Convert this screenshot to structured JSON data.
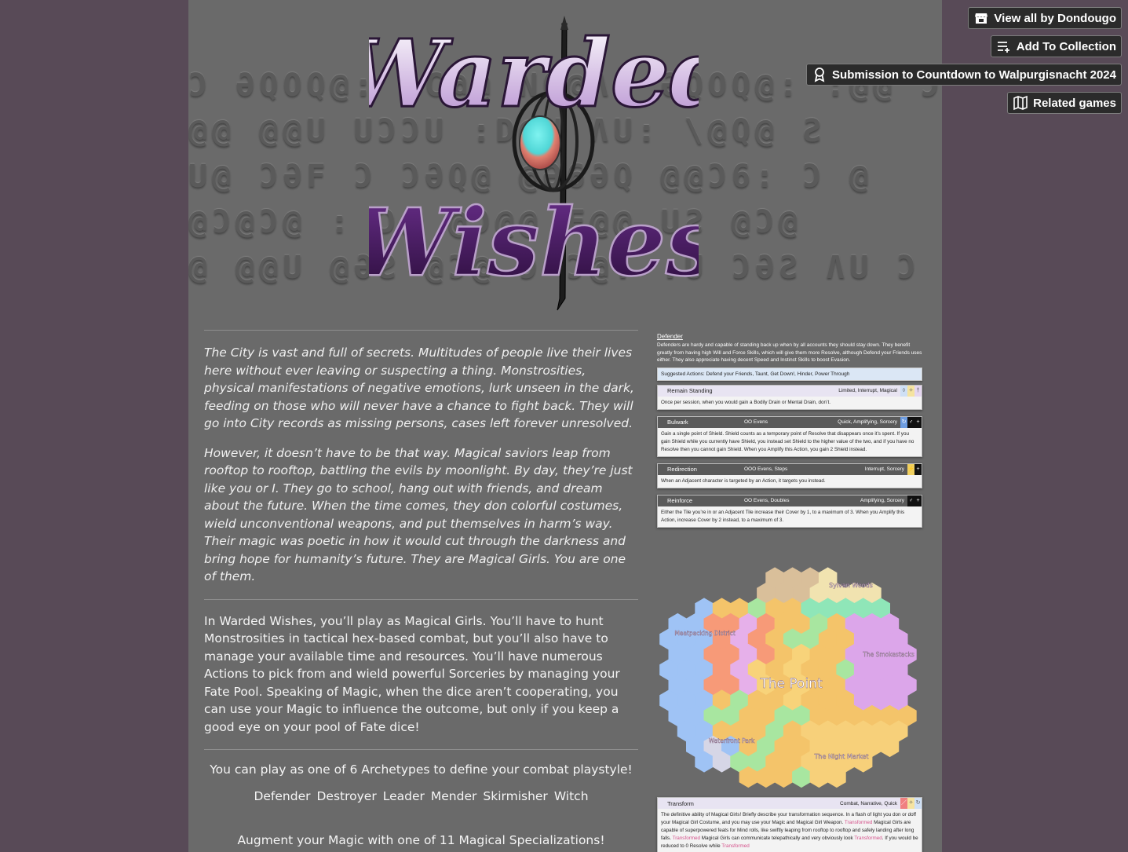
{
  "top_buttons": {
    "view_all": "View all by Dondougo",
    "add_collection": "Add To Collection",
    "submission": "Submission to Countdown to Walpurgisnacht 2024",
    "related": "Related games"
  },
  "banner": {
    "title_line1": "Warded",
    "title_line2": "Wishes",
    "rune_rows": [
      "Ɔ ƏQOQ@: ƏC@@ NQ@Ʌ@ ƏQOQ@: :@@ Ɔ",
      "@@ @@U UƆƆU :D@N ɅU: \\@Q@ Ƨ",
      "U@ ƆƏF Ɔ ƆƏQ@ @Ə6ƏQ @@Ɔ6: Ɔ @",
      "@Ɔ@Ɔ@ : Ɔ@ @Ɔ@@ F@@ UƧ @Ɔ@",
      "@ @@U @ƏƧ @Ɔ@ Ɔ Ɔ@: :U ƆƏƧ ɅU Ɔ"
    ]
  },
  "intro": {
    "p1": "The City is vast and full of secrets. Multitudes of people live their lives here without ever leaving or suspecting a thing. Monstrosities, physical manifestations of negative emotions, lurk unseen in the dark, feeding on those who will never have a chance to fight back. They will go into City records as missing persons, cases left forever unresolved.",
    "p2": "However, it doesn’t have to be that way. Magical saviors leap from rooftop to rooftop, battling the evils by moonlight. By day, they’re just like you or I. They go to school, hang out with friends, and dream about the future. When the time comes, they don colorful costumes, wield unconventional weapons, and put themselves in harm’s way. Their magic was poetic in how it would cut through the darkness and bring hope for humanity’s future. They are Magical Girls. You are one of them."
  },
  "body": {
    "p1": "In Warded Wishes, you’ll play as Magical Girls. You’ll have to hunt Monstrosities in tactical hex-based combat, but you’ll also have to manage your available time and resources. You’ll have numerous Actions to pick from and wield powerful Sorceries by managing your Fate Pool. Speaking of Magic, when the dice aren’t cooperating, you can use your Magic to influence the outcome, but only if you keep a good eye on your pool of Fate dice!",
    "archetype_line": "You can play as one of 6 Archetypes to define your combat playstyle!",
    "archetypes": [
      "Defender",
      "Destroyer",
      "Leader",
      "Mender",
      "Skirmisher",
      "Witch"
    ],
    "specialization_line": "Augment your Magic with one of 11 Magical Specializations!"
  },
  "defender_card": {
    "heading": "Defender",
    "description": "Defenders are hardy and capable of standing back up when by all accounts they should stay down. They benefit greatly from having high Will and Force Skills, which will give them more Resolve, although Defend your Friends uses either. They also appreciate having decent Speed and Instinct Skills to boost Evasion.",
    "suggested": "Suggested Actions: Defend your Friends, Taunt, Get Down!, Hinder, Power Through"
  },
  "cards": [
    {
      "name": "Remain Standing",
      "cost": "",
      "tags": "Limited, Interrupt, Magical",
      "light": true,
      "body": "Once per session, when you would gain a Bodily Drain or Mental Drain, don’t."
    },
    {
      "name": "Bulwark",
      "cost": "OO Evens",
      "tags": "Quick, Amplifying, Sorcery",
      "light": false,
      "body": "Gain a single point of Shield. Shield counts as a temporary point of Resolve that disappears once it’s spent. If you gain Shield while you currently have Shield, you instead set Shield to the higher value of the two, and if you have no Resolve then you cannot gain Shield. When you Amplify this Action, you gain 2 Shield instead."
    },
    {
      "name": "Redirection",
      "cost": "OOO Evens, Steps",
      "tags": "Interrupt, Sorcery",
      "light": false,
      "body": "When an Adjacent character is targeted by an Action, it targets you instead."
    },
    {
      "name": "Reinforce",
      "cost": "OO Evens, Doubles",
      "tags": "Amplifying, Sorcery",
      "light": false,
      "body": "Either the Tile you’re in or an Adjacent Tile increase their Cover by 1, to a maximum of 3. When you Amplify this Action, increase Cover by 2 instead, to a maximum of 3."
    }
  ],
  "map": {
    "labels": {
      "sylvan": "Sylvan Woods",
      "meatpacking": "Meatpacking District",
      "smokestacks": "The Smokestacks",
      "point": "The Point",
      "waterfront": "Waterfront Park",
      "night_market": "The Night Market"
    }
  },
  "transform_card": {
    "name": "Transform",
    "tags": "Combat, Narrative, Quick",
    "body_a": "The definitive ability of Magical Girls! Briefly describe your transformation sequence. In a flash of light you don or doff your Magical Girl Costume, and you may use your Magic and Magical Girl Weapon. ",
    "word": "Transformed",
    "body_b": " Magical Girls are capable of superpowered feats for Mind rolls, like swiftly leaping from rooftop to rooftop and safely landing after long falls. ",
    "body_c": " Magical Girls can communicate telepathically and very obviously look ",
    "body_d": ". If you would be reduced to 0 Resolve while "
  },
  "colors": {
    "page_bg": "#584a57",
    "column_bg": "#6a6a6a",
    "button_bg": "#2b2b2b"
  }
}
